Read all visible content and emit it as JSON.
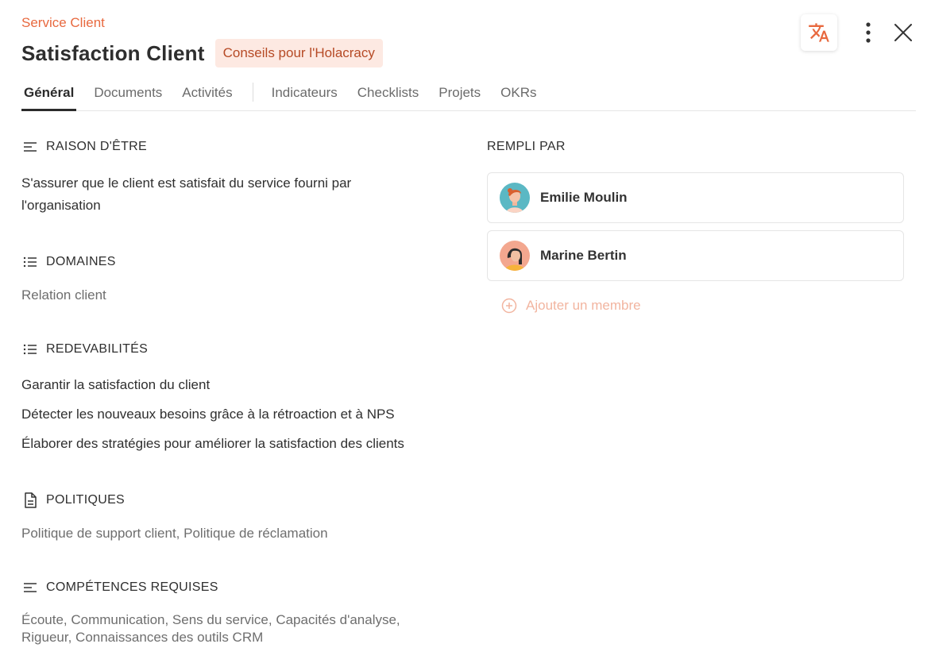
{
  "header": {
    "breadcrumb": "Service Client",
    "title": "Satisfaction Client",
    "badge": "Conseils pour l'Holacracy"
  },
  "tabs": [
    {
      "label": "Général",
      "active": true
    },
    {
      "label": "Documents"
    },
    {
      "label": "Activités"
    },
    {
      "label": "Indicateurs"
    },
    {
      "label": "Checklists"
    },
    {
      "label": "Projets"
    },
    {
      "label": "OKRs"
    }
  ],
  "sections": {
    "purpose": {
      "title": "RAISON D'ÊTRE",
      "lines": [
        "S'assurer que le client est satisfait du service fourni par",
        "l'organisation"
      ]
    },
    "domains": {
      "title": "DOMAINES",
      "text": "Relation client"
    },
    "accountabilities": {
      "title": "REDEVABILITÉS",
      "items": [
        "Garantir la satisfaction du client",
        "Détecter les nouveaux besoins grâce à la rétroaction et à NPS",
        "Élaborer des stratégies pour améliorer la satisfaction des clients"
      ]
    },
    "policies": {
      "title": "POLITIQUES",
      "text": "Politique de support client, Politique de réclamation"
    },
    "skills": {
      "title": "COMPÉTENCES REQUISES",
      "lines": [
        "Écoute, Communication, Sens du service, Capacités d'analyse,",
        "Rigueur, Connaissances des outils CRM"
      ]
    }
  },
  "filled_by": {
    "title": "REMPLI PAR",
    "members": [
      {
        "name": "Emilie Moulin",
        "avatar_color": "#5bb8c4"
      },
      {
        "name": "Marine Bertin",
        "avatar_color": "#f3a78f"
      }
    ],
    "add_label": "Ajouter un membre"
  },
  "colors": {
    "accent": "#e8693f",
    "badge_bg": "#fde9e2",
    "badge_text": "#b64a25",
    "add_member": "#f2b5a0"
  },
  "icons": {
    "translate": "translate-icon",
    "more": "more-vertical-icon",
    "close": "close-icon",
    "text": "text-lines-icon",
    "list": "list-icon",
    "document": "document-icon",
    "add": "plus-circle-icon"
  }
}
